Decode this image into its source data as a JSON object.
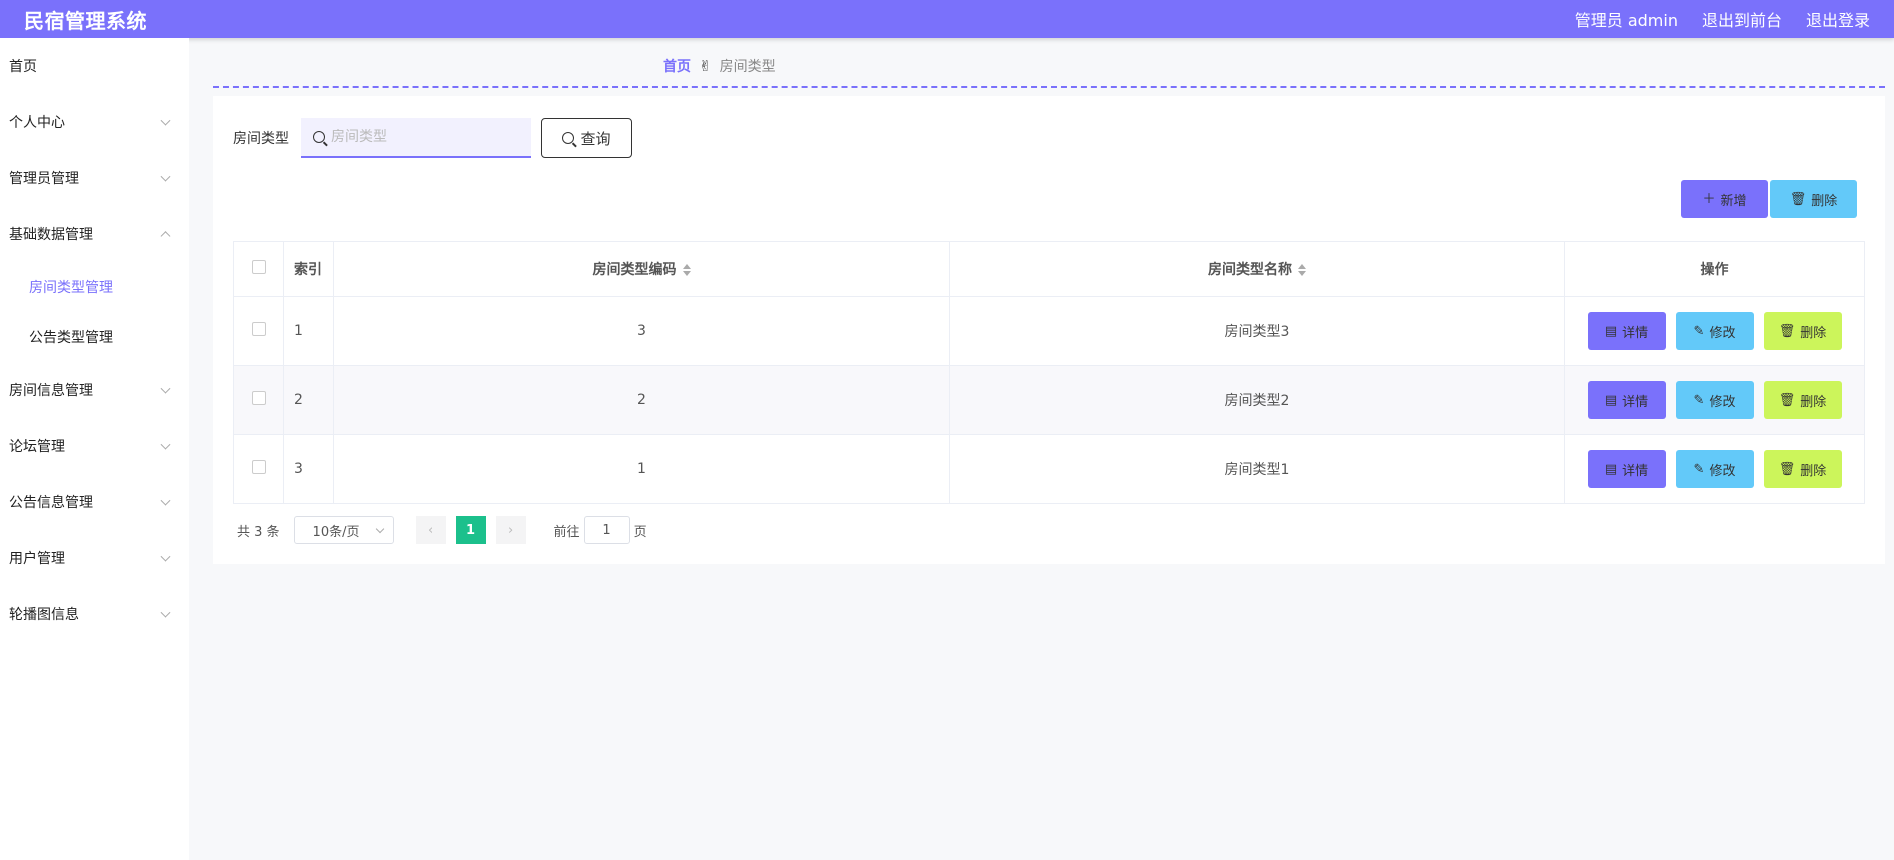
{
  "header": {
    "title": "民宿管理系统",
    "admin_label": "管理员 admin",
    "to_front": "退出到前台",
    "logout": "退出登录"
  },
  "sidebar": {
    "items": [
      {
        "label": "首页",
        "has_chevron": false
      },
      {
        "label": "个人中心",
        "has_chevron": true
      },
      {
        "label": "管理员管理",
        "has_chevron": true
      },
      {
        "label": "基础数据管理",
        "has_chevron": true,
        "expanded": true
      },
      {
        "label": "房间信息管理",
        "has_chevron": true
      },
      {
        "label": "论坛管理",
        "has_chevron": true
      },
      {
        "label": "公告信息管理",
        "has_chevron": true
      },
      {
        "label": "用户管理",
        "has_chevron": true
      },
      {
        "label": "轮播图信息",
        "has_chevron": true
      }
    ],
    "sub_items": [
      {
        "label": "房间类型管理",
        "active": true
      },
      {
        "label": "公告类型管理",
        "active": false
      }
    ]
  },
  "breadcrumb": {
    "home": "首页",
    "separator_icon": "hand-icon",
    "current": "房间类型"
  },
  "search": {
    "label": "房间类型",
    "placeholder": "房间类型",
    "value": "",
    "query_label": "查询"
  },
  "actions": {
    "add_label": "新增",
    "delete_label": "删除"
  },
  "table": {
    "headers": {
      "index": "索引",
      "code": "房间类型编码",
      "name": "房间类型名称",
      "ops": "操作"
    },
    "rows": [
      {
        "index": "1",
        "code": "3",
        "name": "房间类型3"
      },
      {
        "index": "2",
        "code": "2",
        "name": "房间类型2"
      },
      {
        "index": "3",
        "code": "1",
        "name": "房间类型1"
      }
    ],
    "op_labels": {
      "detail": "详情",
      "edit": "修改",
      "delete": "删除"
    }
  },
  "pagination": {
    "total": "共 3 条",
    "page_size": "10条/页",
    "current_page": "1",
    "goto_prefix": "前往",
    "goto_value": "1",
    "goto_suffix": "页"
  },
  "colors": {
    "primary": "#7a71fb",
    "info": "#63c9f9",
    "warning": "#ccf55b",
    "page_active": "#1cc08c"
  }
}
